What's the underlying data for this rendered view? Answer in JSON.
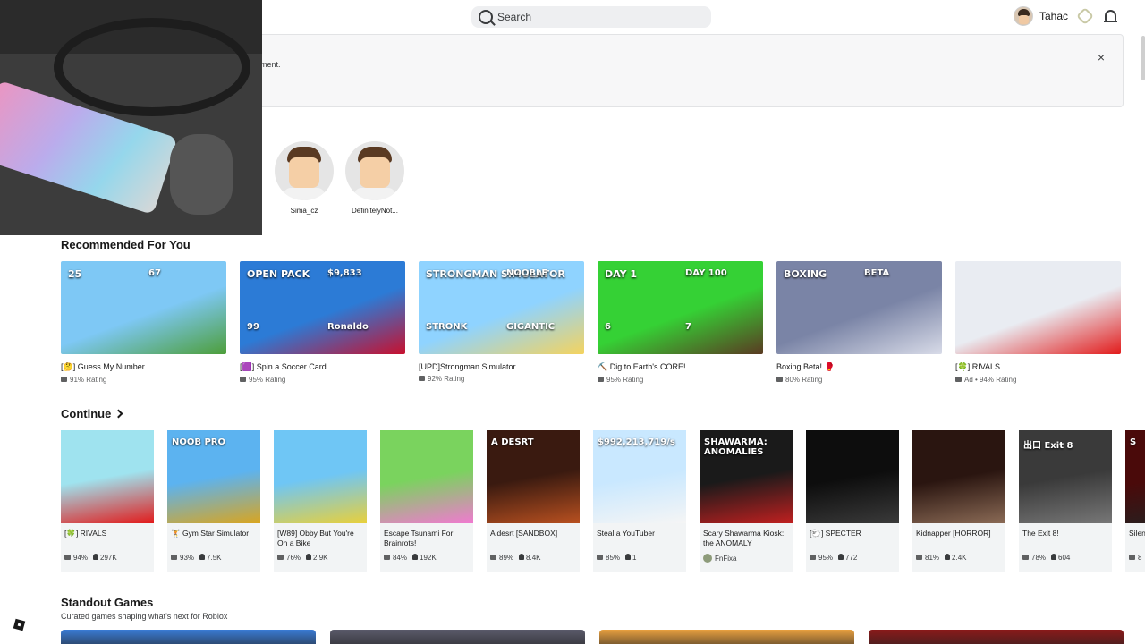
{
  "header": {
    "search_placeholder": "Search",
    "username": "Tahac",
    "icons": [
      "search-icon",
      "robux-icon",
      "bell-icon"
    ]
  },
  "notice": {
    "text": "ment.",
    "close_label": "×"
  },
  "friends": [
    {
      "name": "Sima_cz"
    },
    {
      "name": "DefinitelyNot..."
    }
  ],
  "recommended": {
    "title": "Recommended For You",
    "items": [
      {
        "title": "[🤔] Guess My Number",
        "meta": "91% Rating",
        "thumb_text": [
          "25",
          "67"
        ],
        "colors": [
          "#7ec8f5",
          "#4d9e3a"
        ]
      },
      {
        "title": "[🟪] Spin a Soccer Card",
        "meta": "95% Rating",
        "thumb_text": [
          "OPEN PACK",
          "$9,833",
          "99",
          "Ronaldo"
        ],
        "colors": [
          "#2c7bd6",
          "#c8102e"
        ]
      },
      {
        "title": "[UPD]Strongman Simulator",
        "meta": "92% Rating",
        "thumb_text": [
          "STRONGMAN SIMULATOR",
          "NOOBLE",
          "STRONK",
          "GIGANTIC"
        ],
        "colors": [
          "#8fd3ff",
          "#f4d35e"
        ]
      },
      {
        "title": "⛏️ Dig to Earth's CORE!",
        "meta": "95% Rating",
        "thumb_text": [
          "DAY 1",
          "DAY 100",
          "6",
          "7"
        ],
        "colors": [
          "#35d135",
          "#5a3a22"
        ]
      },
      {
        "title": "Boxing Beta! 🥊",
        "meta": "80% Rating",
        "thumb_text": [
          "BOXING",
          "BETA"
        ],
        "colors": [
          "#7a84a6",
          "#d8dbe8"
        ]
      },
      {
        "title": "[🍀] RIVALS",
        "meta": "Ad • 94% Rating",
        "thumb_text": [],
        "colors": [
          "#e9ecf2",
          "#e21b1b"
        ]
      }
    ]
  },
  "continue": {
    "title": "Continue",
    "items": [
      {
        "title": "[🍀] RIVALS",
        "rating": "94%",
        "players": "297K",
        "colors": [
          "#9fe3ef",
          "#e21b1b"
        ],
        "thumb_text": ""
      },
      {
        "title": "🏋️ Gym Star Simulator",
        "rating": "93%",
        "players": "7.5K",
        "colors": [
          "#5cb3f0",
          "#d9a520"
        ],
        "thumb_text": "NOOB PRO"
      },
      {
        "title": "[W89] Obby But You're On a Bike",
        "rating": "76%",
        "players": "2.9K",
        "colors": [
          "#6fc6f5",
          "#e8d03c"
        ],
        "thumb_text": ""
      },
      {
        "title": "Escape Tsunami For Brainrots!",
        "rating": "84%",
        "players": "192K",
        "colors": [
          "#7ad35e",
          "#f07ad0"
        ],
        "thumb_text": ""
      },
      {
        "title": "A desrt [SANDBOX]",
        "rating": "89%",
        "players": "8.4K",
        "colors": [
          "#3a1a10",
          "#b85020"
        ],
        "thumb_text": "A DESRT"
      },
      {
        "title": "Steal a YouTuber",
        "rating": "85%",
        "players": "1",
        "colors": [
          "#c9e8ff",
          "#f5f5f5"
        ],
        "thumb_text": "$992,213,719/s"
      },
      {
        "title": "Scary Shawarma Kiosk: the ANOMALY",
        "creator": "FnFixa",
        "colors": [
          "#1a1a1a",
          "#c02020"
        ],
        "thumb_text": "SHAWARMA: ANOMALIES"
      },
      {
        "title": "[🐑] SPECTER",
        "rating": "95%",
        "players": "772",
        "colors": [
          "#0d0d0d",
          "#3a3a3a"
        ],
        "thumb_text": ""
      },
      {
        "title": "Kidnapper [HORROR]",
        "rating": "81%",
        "players": "2.4K",
        "colors": [
          "#2a1510",
          "#8a6a55"
        ],
        "thumb_text": ""
      },
      {
        "title": "The Exit 8!",
        "rating": "78%",
        "players": "604",
        "colors": [
          "#3a3a3a",
          "#777"
        ],
        "thumb_text": "出口 Exit 8"
      },
      {
        "title": "Silen [HO",
        "rating": "8",
        "players": "",
        "colors": [
          "#4a0a0a",
          "#222"
        ],
        "thumb_text": "S"
      }
    ]
  },
  "standout": {
    "title": "Standout Games",
    "subtitle": "Curated games shaping what's next for Roblox",
    "colors": [
      "#3a7bd5",
      "#5a5a6a",
      "#e8a040",
      "#8a1a1a"
    ]
  }
}
